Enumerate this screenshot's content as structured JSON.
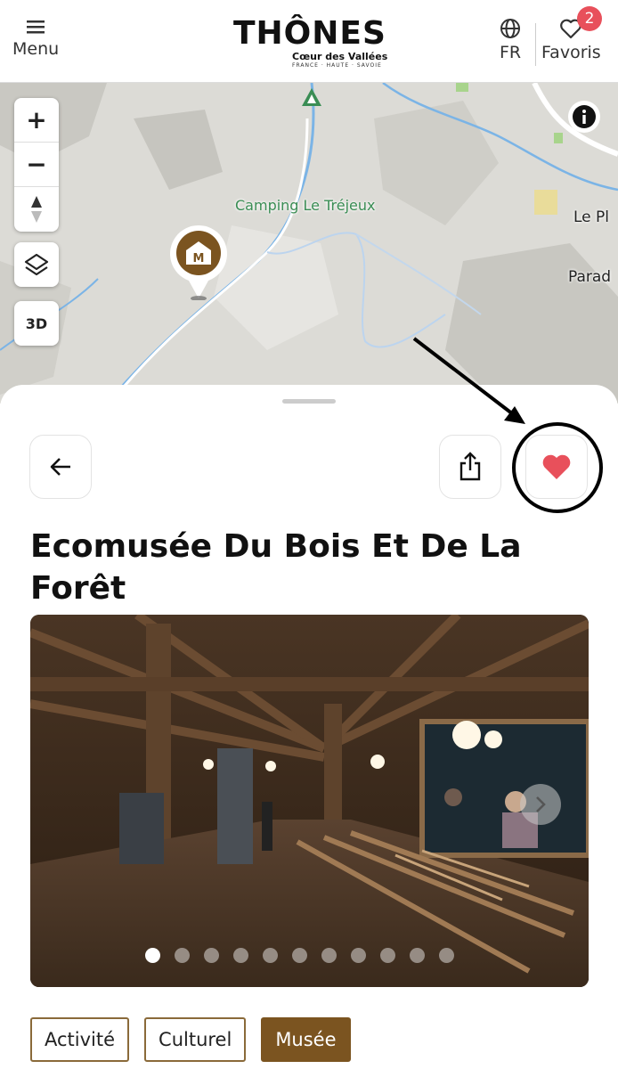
{
  "header": {
    "menu_label": "Menu",
    "logo_text": "THÔNES",
    "logo_sub": "Cœur des Vallées",
    "logo_sub2": "FRANCE · HAUTE · SAVOIE",
    "lang_label": "FR",
    "favorites_label": "Favoris",
    "favorites_count": "2"
  },
  "map": {
    "labels": {
      "camping": "Camping Le Tréjeux",
      "le_pl": "Le Pl",
      "parad": "Parad"
    },
    "controls": {
      "zoom_in": "+",
      "zoom_out": "−",
      "three_d": "3D"
    }
  },
  "detail": {
    "title": "Ecomusée Du Bois Et De La Forêt",
    "gallery": {
      "image_count": 11,
      "active_index": 0
    },
    "tags": [
      "Activité",
      "Culturel",
      "Musée"
    ],
    "favorite_active": true
  },
  "colors": {
    "accent_brown": "#7b5420",
    "heart_red": "#e8505b",
    "camping_green": "#3a8d54"
  }
}
